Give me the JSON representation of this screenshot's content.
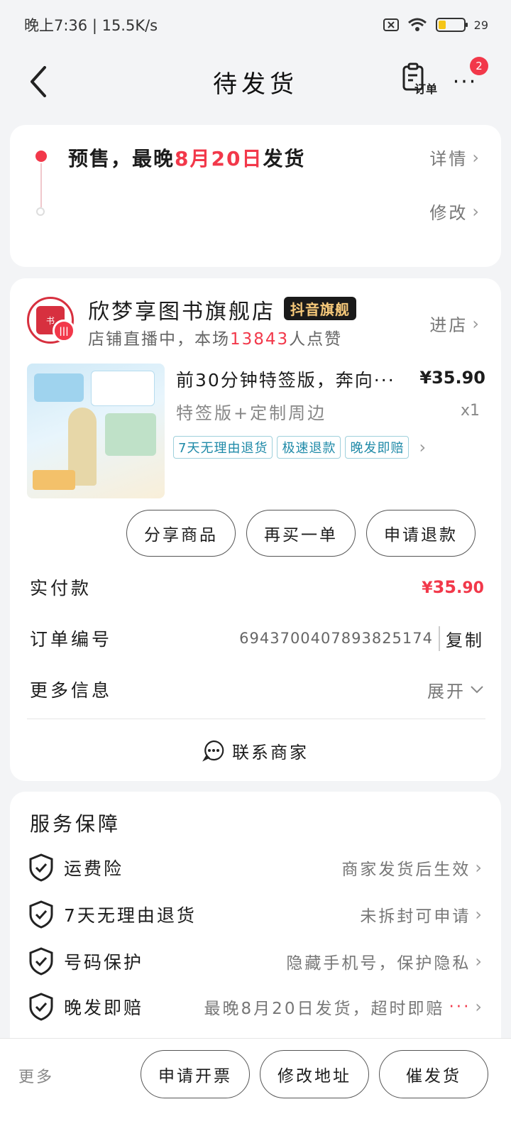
{
  "status_bar": {
    "time_speed": "晚上7:36 | 15.5K/s",
    "battery_pct": "29",
    "battery_level": 0.29
  },
  "nav": {
    "title": "待发货",
    "order_label": "订单",
    "more_label": "···",
    "badge_count": "2"
  },
  "status_card": {
    "presale_prefix": "预售，最晚",
    "presale_date": "8月20日",
    "presale_suffix": "发货",
    "details_label": "详情",
    "modify_label": "修改"
  },
  "shop": {
    "name": "欣梦享图书旗舰店",
    "tag": "抖音旗舰",
    "live_prefix": "店铺直播中，本场",
    "likes": "13843",
    "live_suffix": "人点赞",
    "enter_label": "进店"
  },
  "product": {
    "title": "前30分钟特签版，奔向···",
    "price": "¥35.90",
    "spec": "特签版+定制周边",
    "qty": "x1",
    "tags": [
      "7天无理由退货",
      "极速退款",
      "晚发即赔"
    ]
  },
  "actions": {
    "share": "分享商品",
    "rebuy": "再买一单",
    "refund": "申请退款"
  },
  "info": {
    "paid_label": "实付款",
    "paid_symbol": "¥",
    "paid_int": "35",
    "paid_dec": ".90",
    "order_no_label": "订单编号",
    "order_no": "6943700407893825174",
    "copy_label": "复制",
    "more_info_label": "更多信息",
    "expand_label": "展开",
    "contact_label": "联系商家"
  },
  "service": {
    "title": "服务保障",
    "items": [
      {
        "name": "运费险",
        "desc": "商家发货后生效"
      },
      {
        "name": "7天无理由退货",
        "desc": "未拆封可申请"
      },
      {
        "name": "号码保护",
        "desc": "隐藏手机号，保护隐私"
      },
      {
        "name": "晚发即赔",
        "desc": "最晚8月20日发货，超时即赔",
        "ellipsis": "···"
      }
    ]
  },
  "bottom": {
    "more": "更多",
    "invoice": "申请开票",
    "change_address": "修改地址",
    "urge": "催发货"
  },
  "colors": {
    "accent": "#f2384a",
    "tag_blue": "#1f8aa8",
    "shop_tag_bg": "#1a1a1a",
    "shop_tag_text": "#f6c97a"
  }
}
